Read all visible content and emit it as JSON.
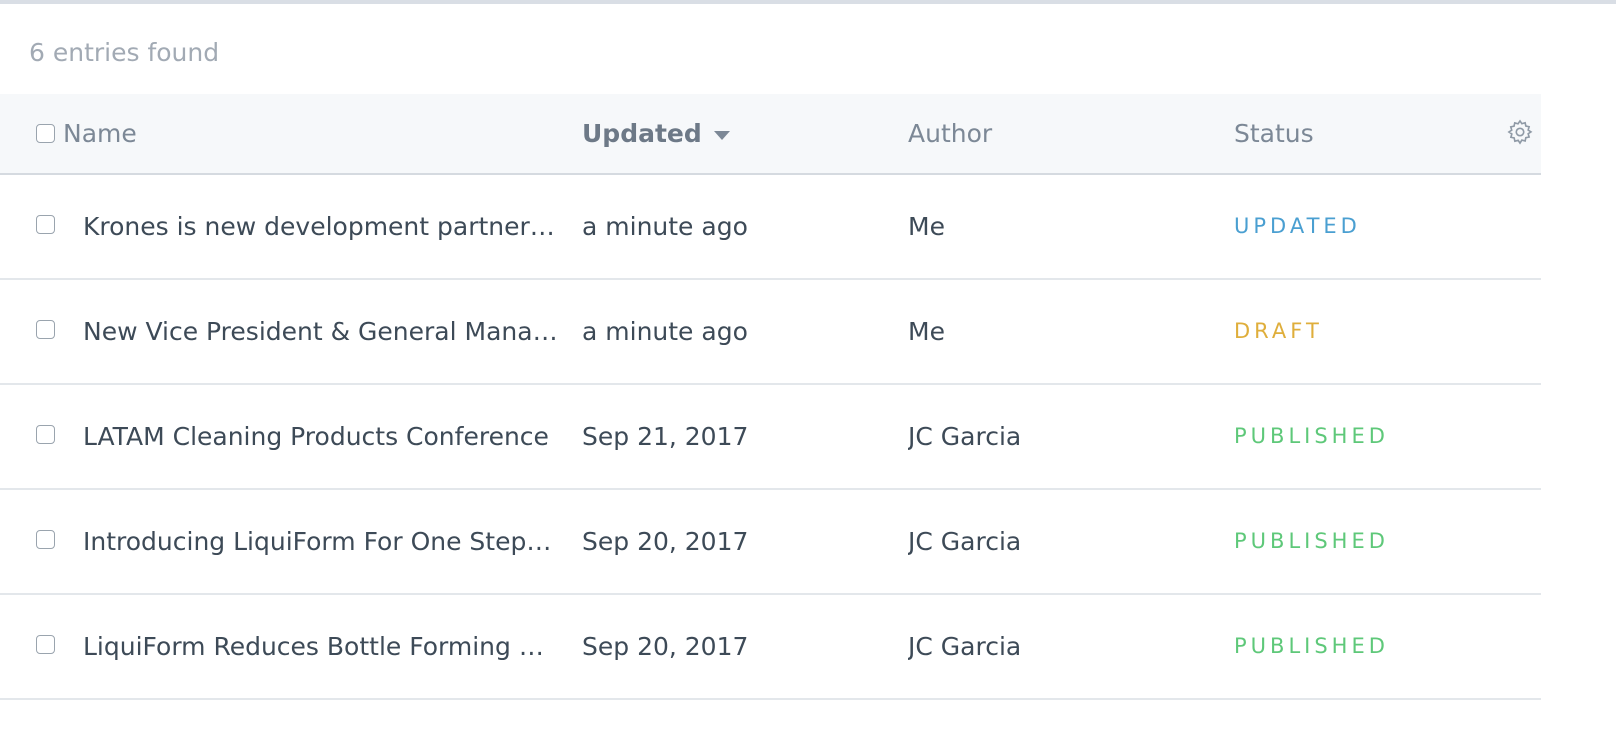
{
  "summary": {
    "entries_found": "6 entries found"
  },
  "table": {
    "columns": {
      "name": "Name",
      "updated": "Updated",
      "author": "Author",
      "status": "Status"
    },
    "rows": [
      {
        "name": "Krones is new development partner for LiquiForm",
        "updated": "a minute ago",
        "author": "Me",
        "status": "UPDATED",
        "status_color": "#4a9fd1"
      },
      {
        "name": "New Vice President & General Manager",
        "updated": "a minute ago",
        "author": "Me",
        "status": "DRAFT",
        "status_color": "#dfae3b"
      },
      {
        "name": "LATAM Cleaning Products Conference",
        "updated": "Sep 21, 2017",
        "author": "JC Garcia",
        "status": "PUBLISHED",
        "status_color": "#5ec879"
      },
      {
        "name": "Introducing LiquiForm For One Step Container Forming",
        "updated": "Sep 20, 2017",
        "author": "JC Garcia",
        "status": "PUBLISHED",
        "status_color": "#5ec879"
      },
      {
        "name": "LiquiForm Reduces Bottle Forming Steps",
        "updated": "Sep 20, 2017",
        "author": "JC Garcia",
        "status": "PUBLISHED",
        "status_color": "#5ec879"
      }
    ]
  },
  "icons": {
    "settings": "gear-icon",
    "sort": "caret-down-icon"
  }
}
